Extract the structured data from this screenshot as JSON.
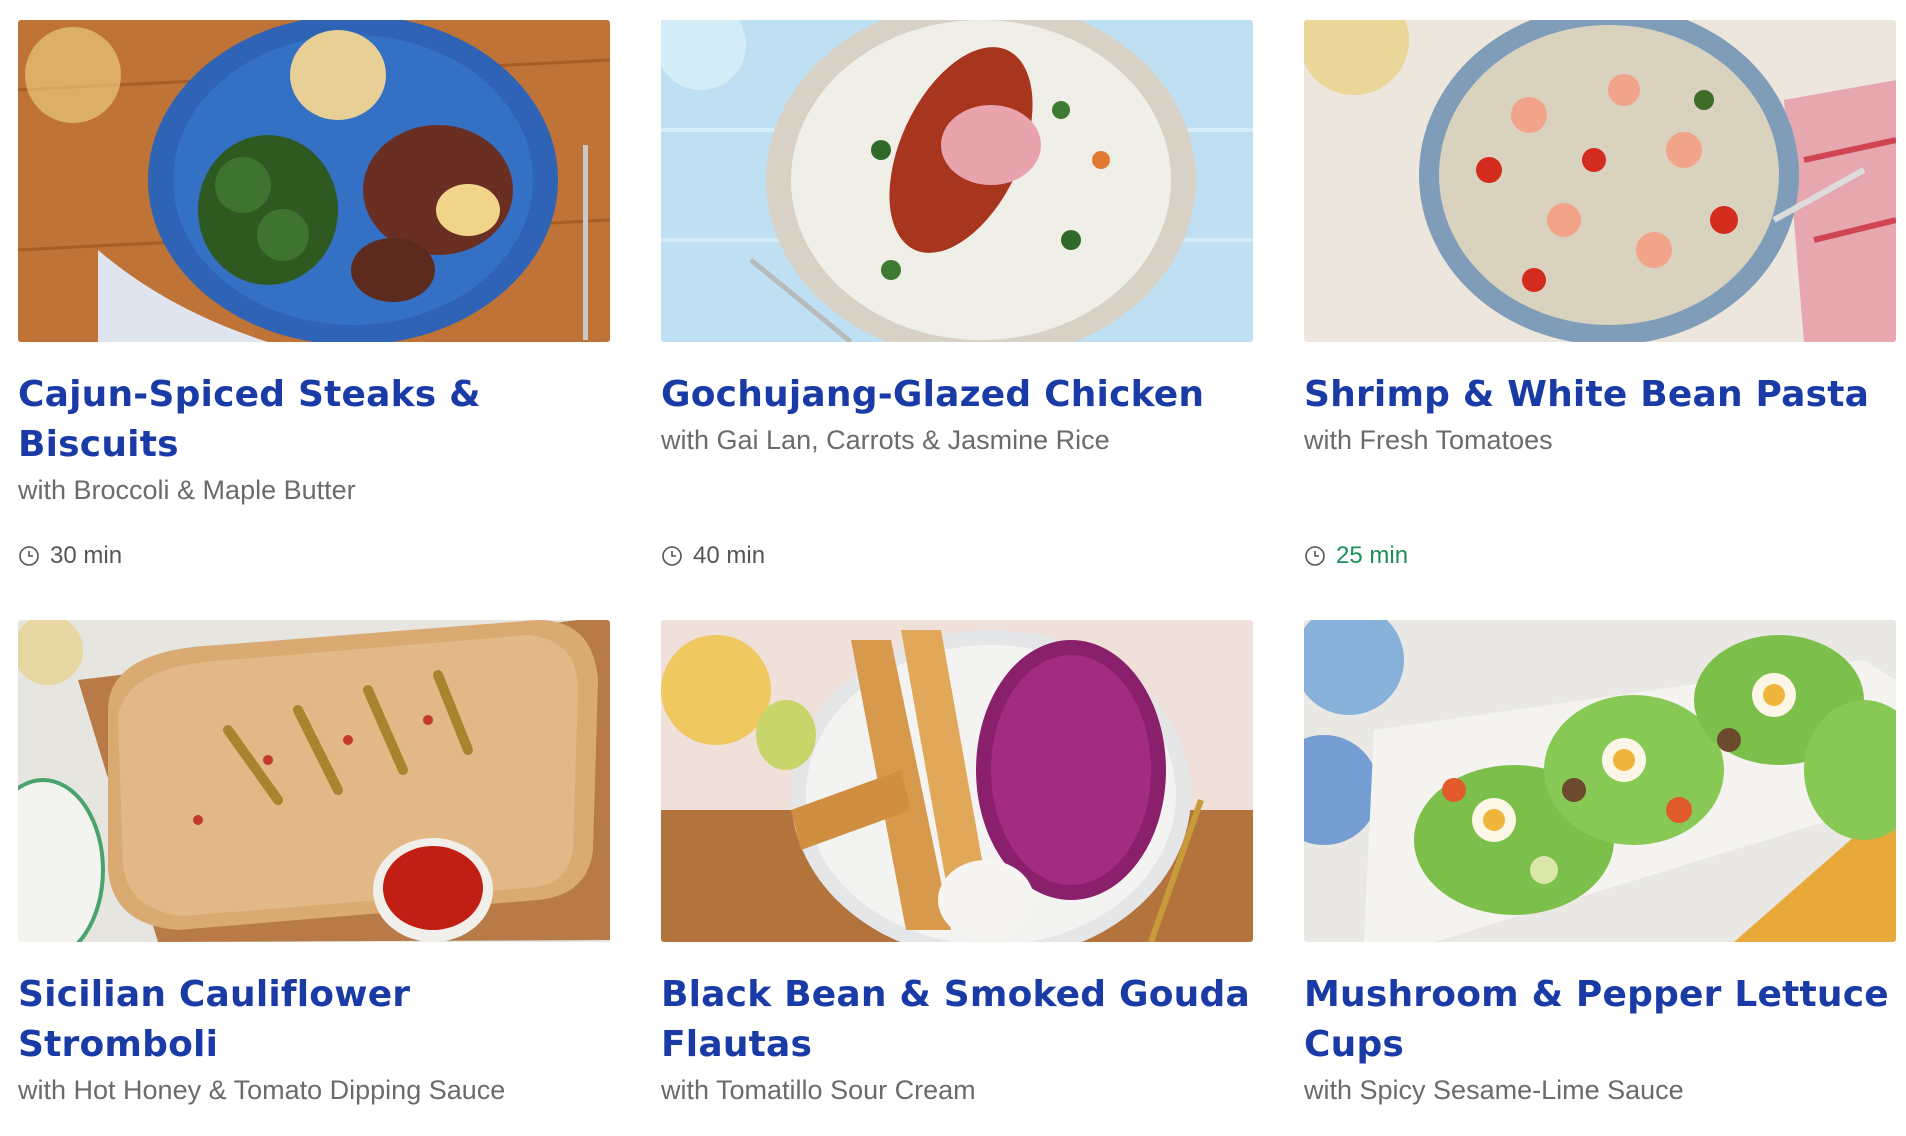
{
  "recipes": [
    {
      "title": "Cajun-Spiced Steaks & Biscuits",
      "subtitle": "with Broccoli & Maple Butter",
      "time": "30 min",
      "time_color": "#555555",
      "image": "steak-plate-image"
    },
    {
      "title": "Gochujang-Glazed Chicken",
      "subtitle": "with Gai Lan, Carrots & Jasmine Rice",
      "time": "40 min",
      "time_color": "#555555",
      "image": "chicken-rice-bowl-image"
    },
    {
      "title": "Shrimp & White Bean Pasta",
      "subtitle": "with Fresh Tomatoes",
      "time": "25 min",
      "time_color": "#1a8f5a",
      "image": "shrimp-pasta-bowl-image"
    },
    {
      "title": "Sicilian Cauliflower Stromboli",
      "subtitle": "with Hot Honey & Tomato Dipping Sauce",
      "image": "stromboli-board-image"
    },
    {
      "title": "Black Bean & Smoked Gouda Flautas",
      "subtitle": "with Tomatillo Sour Cream",
      "image": "flautas-plate-image"
    },
    {
      "title": "Mushroom & Pepper Lettuce Cups",
      "subtitle": "with Spicy Sesame-Lime Sauce",
      "image": "lettuce-cups-tray-image"
    }
  ],
  "colors": {
    "title": "#1a3aa6",
    "subtitle": "#6b6b6b",
    "time_default": "#555555",
    "time_highlight": "#1a8f5a"
  }
}
